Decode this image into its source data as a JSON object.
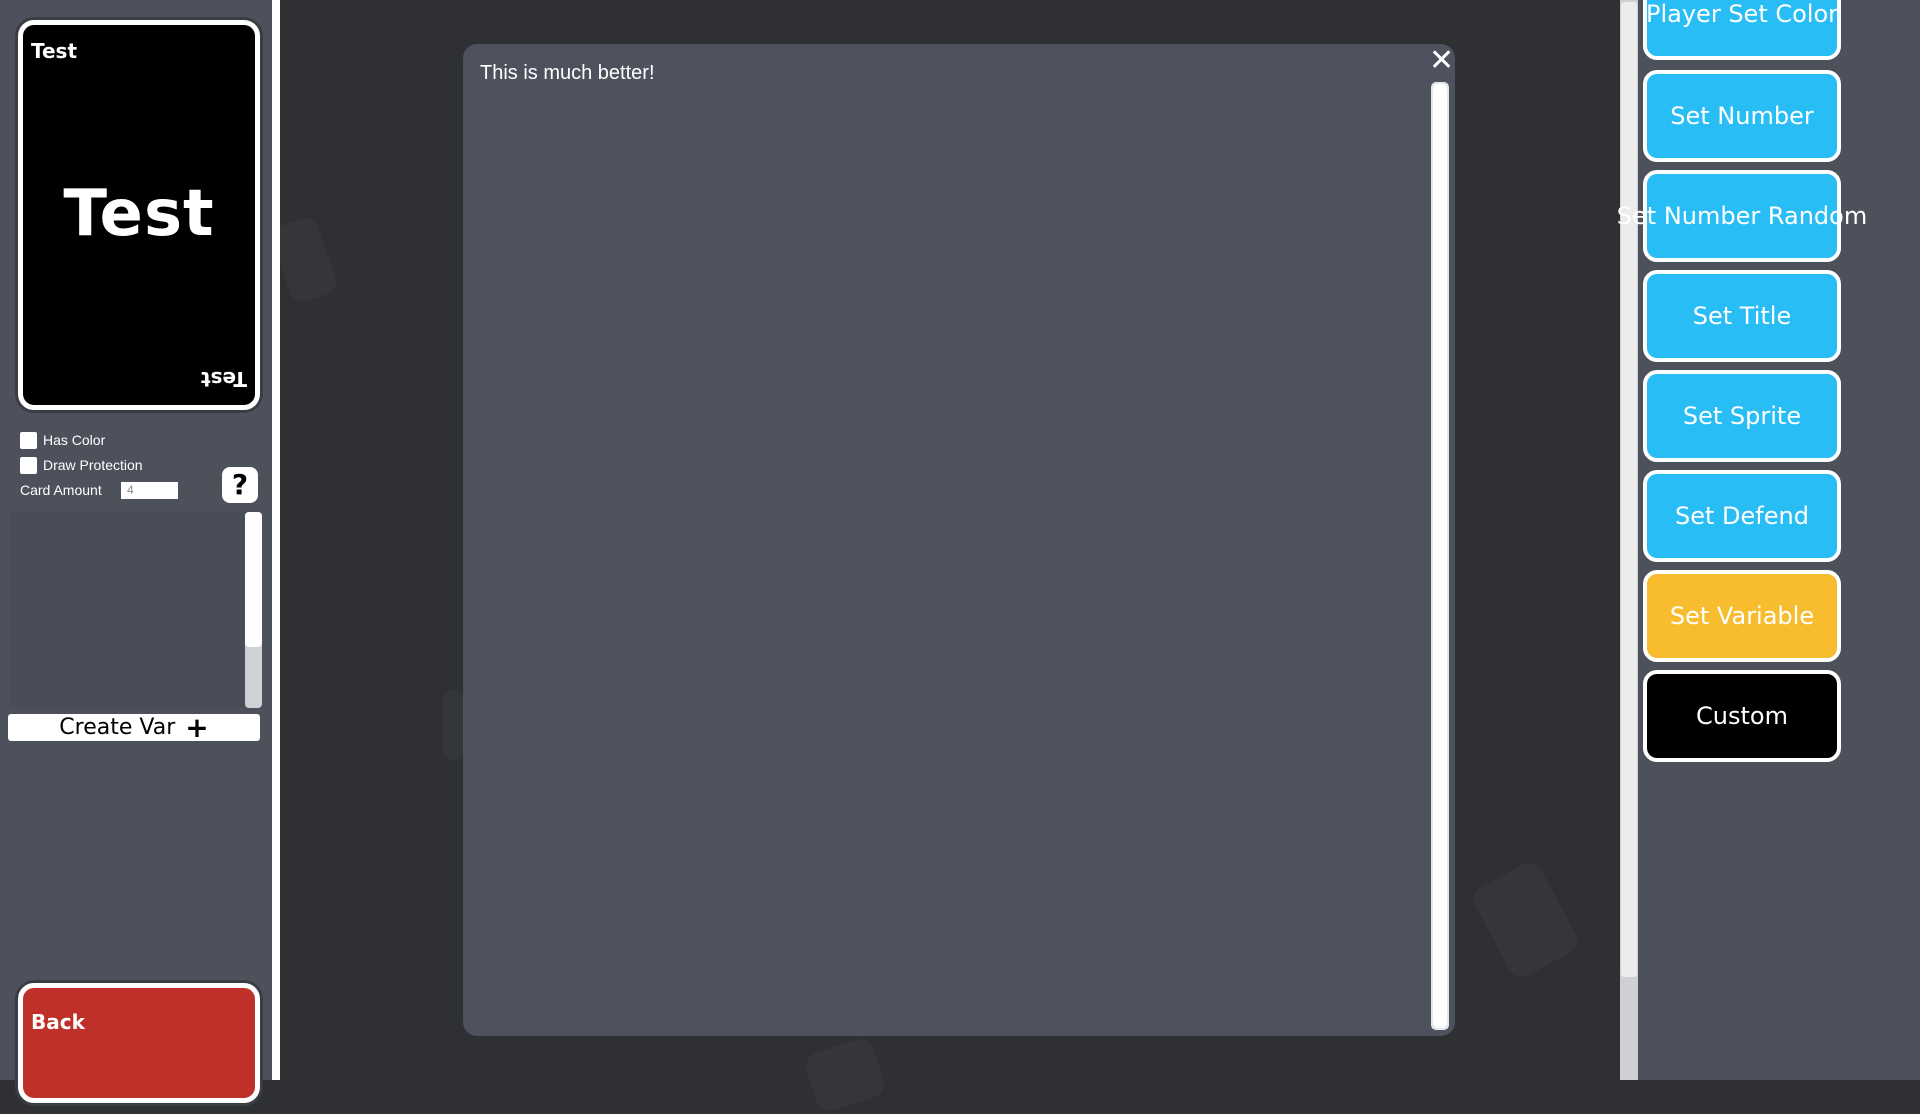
{
  "card": {
    "corner_title": "Test",
    "center_title": "Test",
    "corner_title_flipped": "Test",
    "background": "#000000"
  },
  "options": {
    "has_color_label": "Has Color",
    "draw_protection_label": "Draw Protection",
    "card_amount_label": "Card Amount",
    "card_amount_value": "4",
    "help_label": "?"
  },
  "variables": {
    "create_label": "Create Var",
    "create_icon": "plus-icon"
  },
  "back_card": {
    "label": "Back",
    "background": "#c0302a"
  },
  "modal": {
    "text": "This is much better!",
    "close_label": "✕"
  },
  "actions": [
    {
      "label": "Player Set Color",
      "color": "#29bdf5"
    },
    {
      "label": "Set Number",
      "color": "#29bdf5"
    },
    {
      "label": "Set Number Random",
      "color": "#29bdf5"
    },
    {
      "label": "Set Title",
      "color": "#29bdf5"
    },
    {
      "label": "Set Sprite",
      "color": "#29bdf5"
    },
    {
      "label": "Set Defend",
      "color": "#29bdf5"
    },
    {
      "label": "Set Variable",
      "color": "#f8bd2e"
    },
    {
      "label": "Custom",
      "color": "#000000"
    }
  ]
}
